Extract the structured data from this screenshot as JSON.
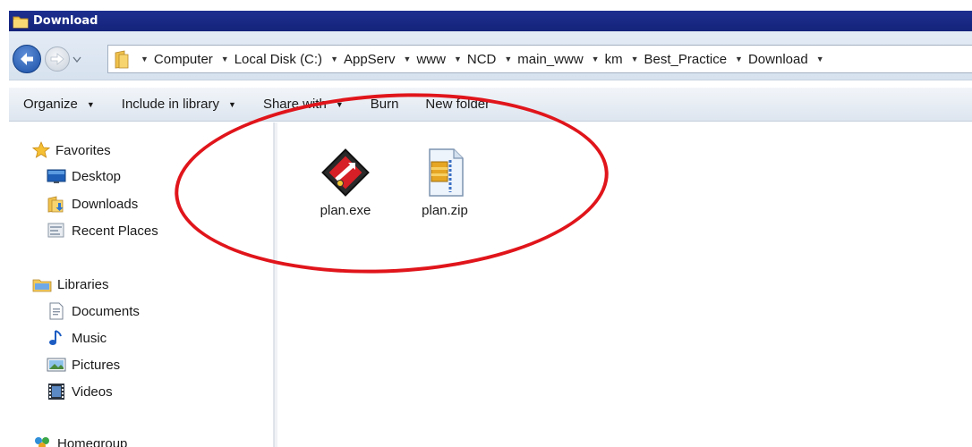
{
  "window": {
    "title": "Download"
  },
  "address": {
    "breadcrumbs": [
      "Computer",
      "Local Disk (C:)",
      "AppServ",
      "www",
      "NCD",
      "main_www",
      "km",
      "Best_Practice",
      "Download"
    ]
  },
  "toolbar": {
    "organize": "Organize",
    "include_in_library": "Include in library",
    "share_with": "Share with",
    "burn": "Burn",
    "new_folder": "New folder"
  },
  "nav": {
    "favorites": "Favorites",
    "desktop": "Desktop",
    "downloads": "Downloads",
    "recent_places": "Recent Places",
    "libraries": "Libraries",
    "documents": "Documents",
    "music": "Music",
    "pictures": "Pictures",
    "videos": "Videos",
    "homegroup": "Homegroup"
  },
  "files": [
    {
      "name": "plan.exe",
      "icon": "exe-app-icon"
    },
    {
      "name": "plan.zip",
      "icon": "zip-archive-icon"
    }
  ],
  "colors": {
    "titlebar": "#1d2f8f",
    "highlight": "#e0151b",
    "nav_blue": "#1b4fa6"
  }
}
